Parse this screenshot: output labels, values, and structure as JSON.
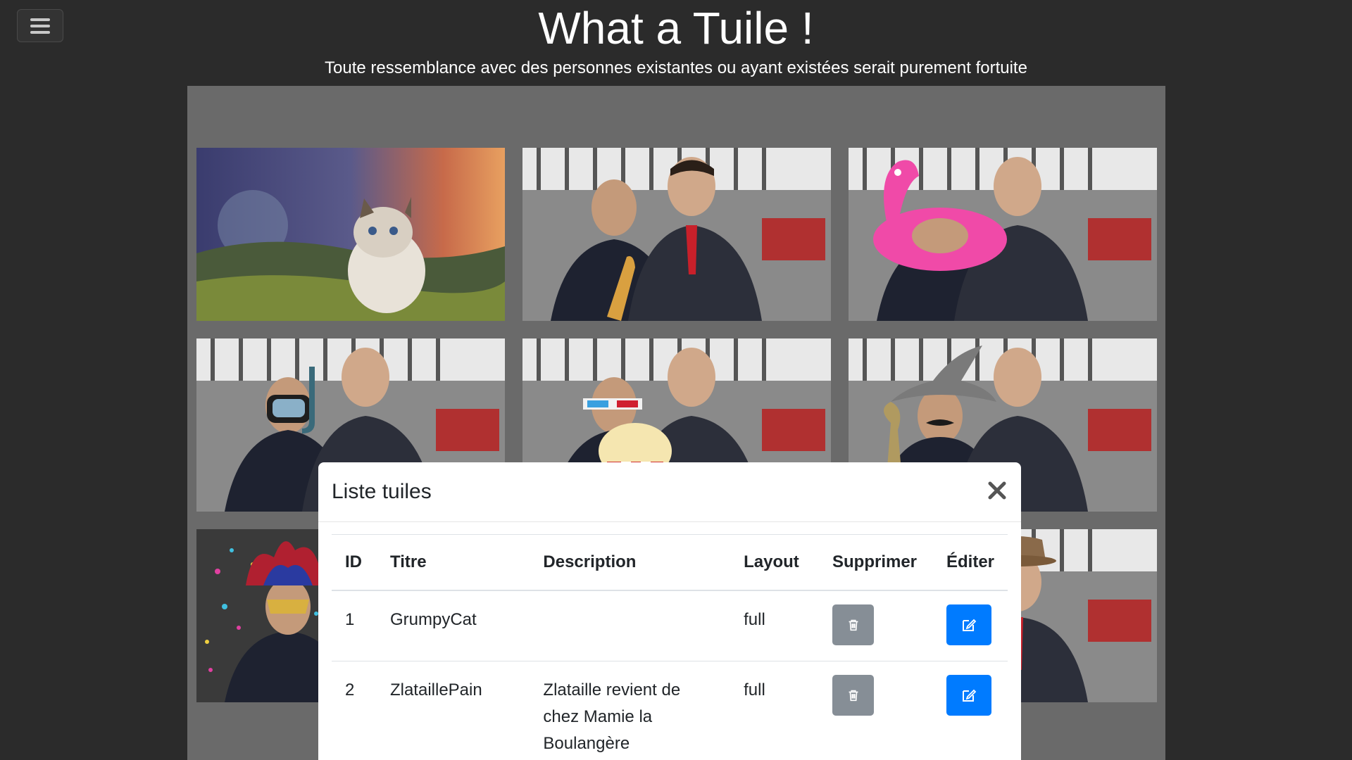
{
  "header": {
    "title": "What a Tuile !",
    "subtitle": "Toute ressemblance avec des personnes existantes ou ayant existées serait purement fortuite",
    "menu_icon": "hamburger-icon"
  },
  "tiles": [
    {
      "name": "GrumpyCat",
      "accessory": "cat"
    },
    {
      "name": "ZlataillePain",
      "accessory": "baguette"
    },
    {
      "name": "flamingo",
      "accessory": "flamingo"
    },
    {
      "name": "snorkel",
      "accessory": "snorkel"
    },
    {
      "name": "3d-glasses",
      "accessory": "popcorn"
    },
    {
      "name": "wizard",
      "accessory": "wizard-hat"
    },
    {
      "name": "jester",
      "accessory": "jester-hat"
    },
    {
      "name": "fedora",
      "accessory": "fedora"
    }
  ],
  "modal": {
    "title": "Liste tuiles",
    "close_icon": "close-icon",
    "columns": [
      "ID",
      "Titre",
      "Description",
      "Layout",
      "Supprimer",
      "Éditer"
    ],
    "rows": [
      {
        "id": "1",
        "titre": "GrumpyCat",
        "description": "",
        "layout": "full"
      },
      {
        "id": "2",
        "titre": "ZlataillePain",
        "description": "Zlataille revient de chez Mamie la Boulangère",
        "layout": "full"
      }
    ],
    "delete_icon": "trash-icon",
    "edit_icon": "edit-icon"
  },
  "colors": {
    "background": "#2b2b2b",
    "board": "#6a6a6a",
    "delete_button": "#868e96",
    "edit_button": "#007bff"
  }
}
